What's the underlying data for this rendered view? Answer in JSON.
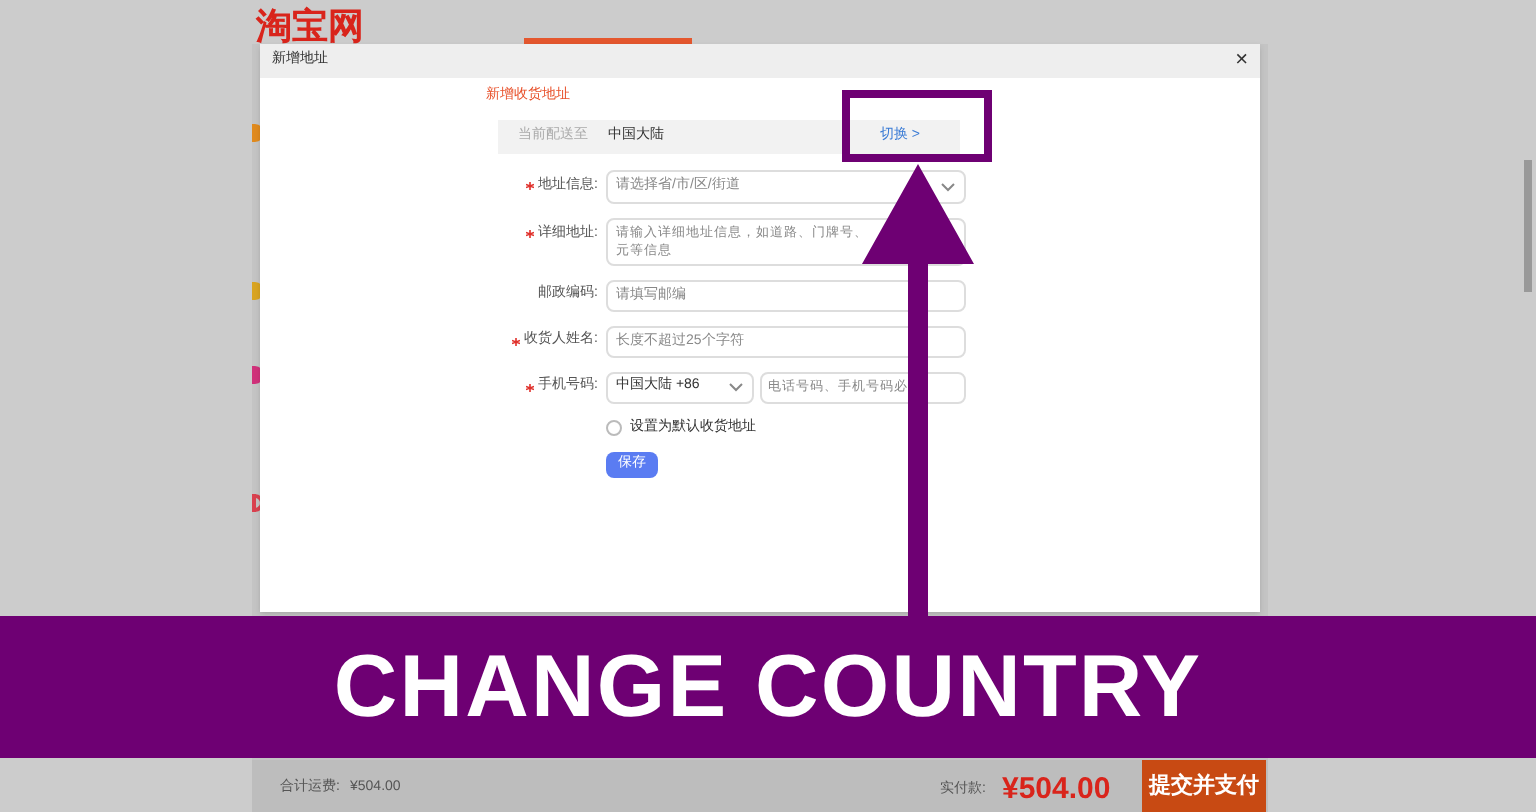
{
  "page": {
    "logo": "淘宝网",
    "footer": {
      "shipping_label": "合计运费:",
      "shipping_value": "¥504.00",
      "pay_label": "实付款:",
      "pay_value": "¥504.00",
      "submit": "提交并支付"
    }
  },
  "dialog": {
    "title": "新增地址",
    "close": "×",
    "heading": "新增收货地址",
    "delivery": {
      "label": "当前配送至",
      "value": "中国大陆",
      "switch": "切换 >"
    },
    "fields": [
      {
        "kind": "select",
        "label": "地址信息:",
        "required": true,
        "placeholder": "请选择省/市/区/街道"
      },
      {
        "kind": "textarea",
        "label": "详细地址:",
        "required": true,
        "placeholder_lines": [
          "请输入详细地址信息，如道路、门牌号、",
          "元等信息"
        ]
      },
      {
        "kind": "input",
        "label": "邮政编码:",
        "required": false,
        "placeholder": "请填写邮编"
      },
      {
        "kind": "input",
        "label": "收货人姓名:",
        "required": true,
        "placeholder": "长度不超过25个字符"
      },
      {
        "kind": "phone",
        "label": "手机号码:",
        "required": true,
        "code": "中国大陆 +86",
        "placeholder": "电话号码、手机号码必"
      }
    ],
    "default_checkbox": {
      "label": "设置为默认收货地址",
      "checked": false
    },
    "save": "保存"
  },
  "banner": {
    "text": "CHANGE COUNTRY"
  }
}
